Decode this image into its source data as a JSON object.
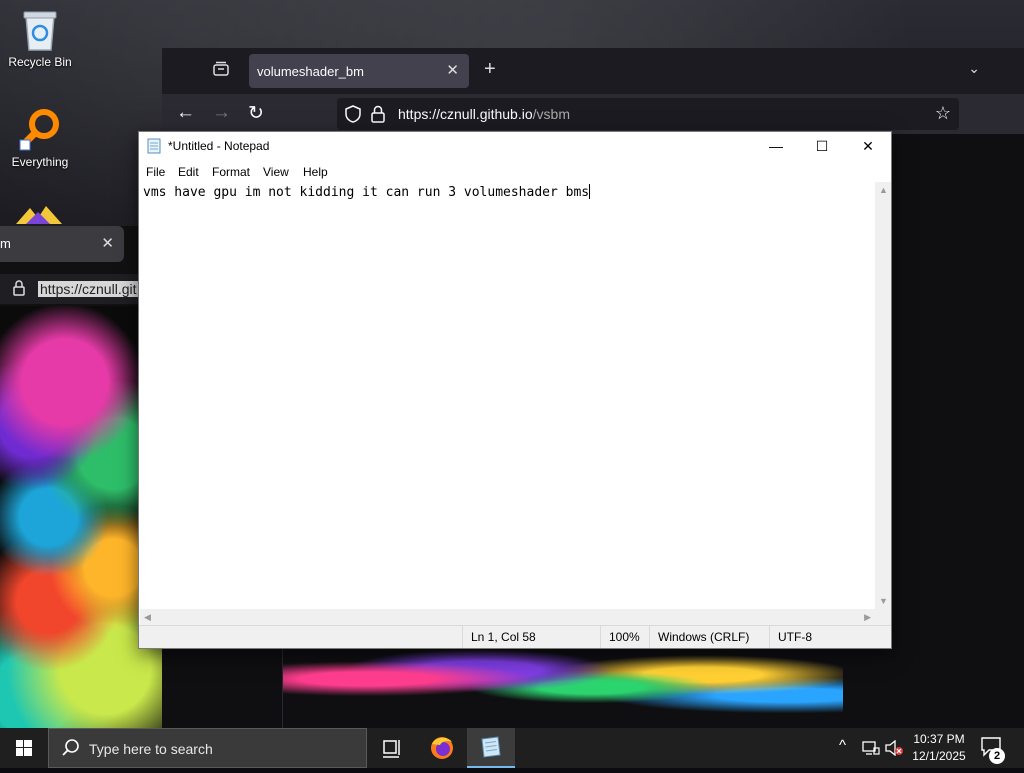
{
  "desktop": {
    "icons": [
      {
        "label": "Recycle Bin",
        "icon": "recycle-bin-icon"
      },
      {
        "label": "Everything",
        "icon": "everything-search-icon"
      }
    ]
  },
  "browser_back": {
    "tab_title": "m",
    "url_selected": "https://cznull.git"
  },
  "browser_front": {
    "tab_title": "volumeshader_bm",
    "url_host": "https://cznull.github.io",
    "url_path": "/vsbm"
  },
  "notepad": {
    "title": "*Untitled - Notepad",
    "menu": [
      "File",
      "Edit",
      "Format",
      "View",
      "Help"
    ],
    "content": "vms have gpu im not kidding it can run 3 volumeshader bms",
    "status": {
      "position": "Ln 1, Col 58",
      "zoom": "100%",
      "line_ending": "Windows (CRLF)",
      "encoding": "UTF-8"
    }
  },
  "taskbar": {
    "search_placeholder": "Type here to search",
    "time": "10:37 PM",
    "date": "12/1/2025",
    "notification_count": "2"
  },
  "colors": {
    "taskbar_bg": "#1f1f1f",
    "browser_bg": "#1c1b22",
    "accent": "#76b9ed"
  }
}
